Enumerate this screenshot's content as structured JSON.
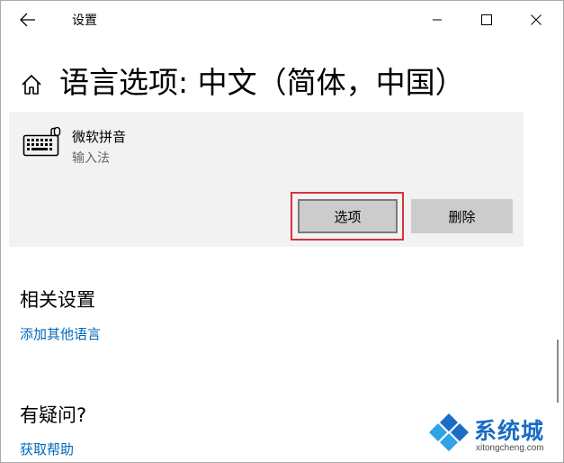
{
  "window": {
    "title": "设置"
  },
  "page": {
    "title": "语言选项: 中文（简体，中国）"
  },
  "keyboard": {
    "name": "微软拼音",
    "type": "输入法",
    "options_label": "选项",
    "delete_label": "删除"
  },
  "related": {
    "title": "相关设置",
    "add_language_link": "添加其他语言"
  },
  "question": {
    "title": "有疑问?",
    "help_link": "获取帮助"
  },
  "icons": {
    "back": "back-arrow-icon",
    "minimize": "minimize-icon",
    "maximize": "maximize-icon",
    "close": "close-icon",
    "home": "home-icon",
    "keyboard": "keyboard-icon"
  },
  "colors": {
    "accent_link": "#0067b8",
    "panel_bg": "#f2f2f2",
    "button_bg": "#cccccc",
    "highlight": "#d9323b"
  },
  "watermark": {
    "text": "系统城",
    "url": "xitongcheng.com"
  }
}
